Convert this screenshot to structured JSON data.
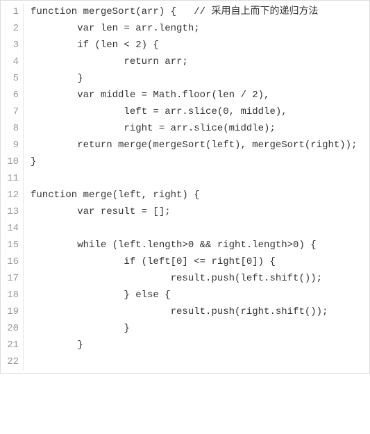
{
  "chart_data": {
    "type": "table",
    "title": "JavaScript mergeSort code listing",
    "lines": [
      {
        "n": 1,
        "code": "function mergeSort(arr) {   // 采用自上而下的递归方法"
      },
      {
        "n": 2,
        "code": "        var len = arr.length;"
      },
      {
        "n": 3,
        "code": "        if (len < 2) {"
      },
      {
        "n": 4,
        "code": "                return arr;"
      },
      {
        "n": 5,
        "code": "        }"
      },
      {
        "n": 6,
        "code": "        var middle = Math.floor(len / 2),"
      },
      {
        "n": 7,
        "code": "                left = arr.slice(0, middle),"
      },
      {
        "n": 8,
        "code": "                right = arr.slice(middle);"
      },
      {
        "n": 9,
        "code": "        return merge(mergeSort(left), mergeSort(right));"
      },
      {
        "n": 10,
        "code": "}"
      },
      {
        "n": 11,
        "code": ""
      },
      {
        "n": 12,
        "code": "function merge(left, right) {"
      },
      {
        "n": 13,
        "code": "        var result = [];"
      },
      {
        "n": 14,
        "code": ""
      },
      {
        "n": 15,
        "code": "        while (left.length>0 && right.length>0) {"
      },
      {
        "n": 16,
        "code": "                if (left[0] <= right[0]) {"
      },
      {
        "n": 17,
        "code": "                        result.push(left.shift());"
      },
      {
        "n": 18,
        "code": "                } else {"
      },
      {
        "n": 19,
        "code": "                        result.push(right.shift());"
      },
      {
        "n": 20,
        "code": "                }"
      },
      {
        "n": 21,
        "code": "        }"
      },
      {
        "n": 22,
        "code": ""
      }
    ]
  }
}
